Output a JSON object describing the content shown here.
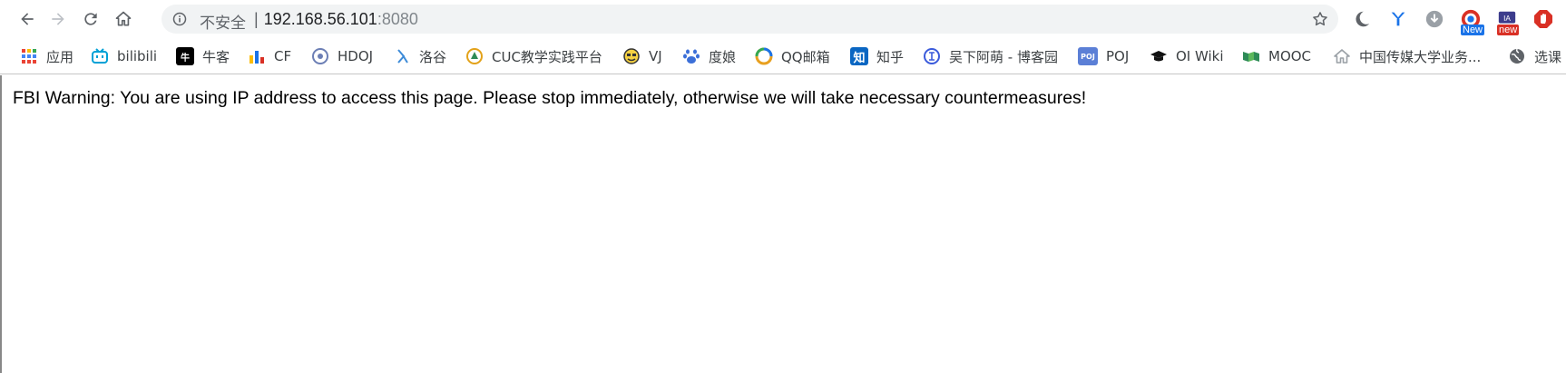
{
  "toolbar": {
    "security_label": "不安全",
    "separator": "|",
    "url_host": "192.168.56.101",
    "url_port": ":8080",
    "extensions": {
      "badge_new_1": "New",
      "badge_new_2": "new"
    }
  },
  "bookmarks": [
    {
      "label": "应用",
      "icon": "apps-grid-icon"
    },
    {
      "label": "bilibili",
      "icon": "bilibili-icon"
    },
    {
      "label": "牛客",
      "icon": "nowcoder-icon"
    },
    {
      "label": "CF",
      "icon": "codeforces-icon"
    },
    {
      "label": "HDOJ",
      "icon": "hdoj-icon"
    },
    {
      "label": "洛谷",
      "icon": "luogu-icon"
    },
    {
      "label": "CUC教学实践平台",
      "icon": "cuc-icon"
    },
    {
      "label": "VJ",
      "icon": "vjudge-icon"
    },
    {
      "label": "度娘",
      "icon": "baidu-icon"
    },
    {
      "label": "QQ邮箱",
      "icon": "qqmail-icon"
    },
    {
      "label": "知乎",
      "icon": "zhihu-icon"
    },
    {
      "label": "吴下阿萌 - 博客园",
      "icon": "cnblogs-icon"
    },
    {
      "label": "POJ",
      "icon": "poj-icon"
    },
    {
      "label": "OI Wiki",
      "icon": "oiwiki-icon"
    },
    {
      "label": "MOOC",
      "icon": "mooc-icon"
    },
    {
      "label": "中国传媒大学业务...",
      "icon": "home-icon"
    },
    {
      "label": "选课",
      "icon": "globe-icon"
    }
  ],
  "page": {
    "message": "FBI Warning: You are using IP address to access this page. Please stop immediately, otherwise we will take necessary countermeasures!"
  },
  "colors": {
    "omnibox_bg": "#f1f3f4",
    "badge_blue": "#1a73e8",
    "badge_red": "#d93025"
  }
}
